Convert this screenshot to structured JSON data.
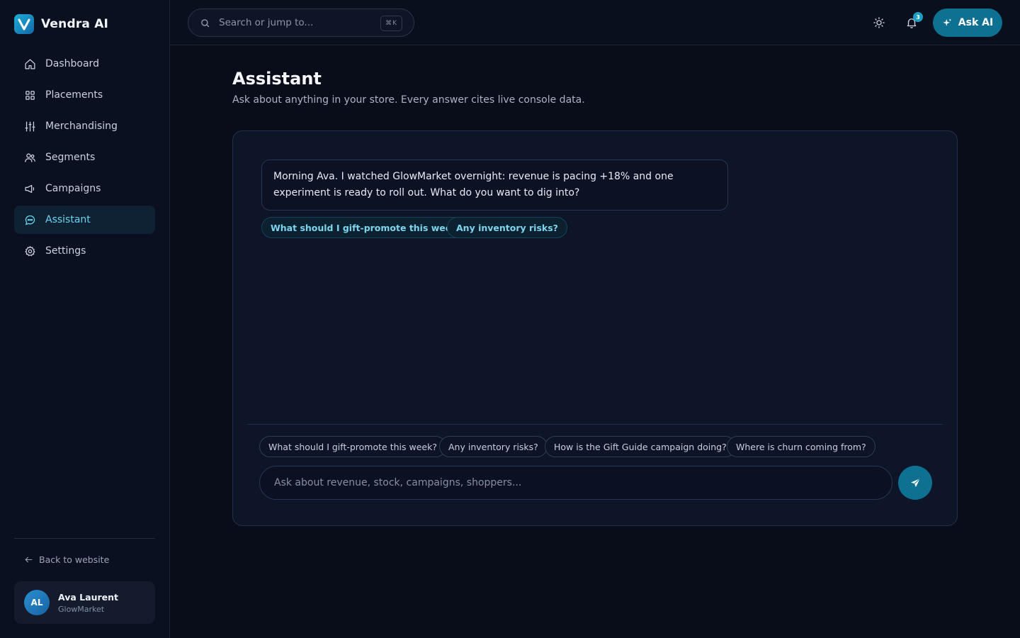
{
  "brand": {
    "name": "Vendra AI"
  },
  "sidebar": {
    "items": [
      {
        "label": "Dashboard",
        "icon": "home-icon",
        "active": false
      },
      {
        "label": "Placements",
        "icon": "grid-icon",
        "active": false
      },
      {
        "label": "Merchandising",
        "icon": "sliders-icon",
        "active": false
      },
      {
        "label": "Segments",
        "icon": "users-icon",
        "active": false
      },
      {
        "label": "Campaigns",
        "icon": "megaphone-icon",
        "active": false
      },
      {
        "label": "Assistant",
        "icon": "chat-bubble-icon",
        "active": true
      },
      {
        "label": "Settings",
        "icon": "gear-icon",
        "active": false
      }
    ],
    "back_link": "Back to website",
    "user": {
      "initials": "AL",
      "name": "Ava Laurent",
      "org": "GlowMarket"
    }
  },
  "topbar": {
    "search_placeholder": "Search or jump to...",
    "search_shortcut": "⌘K",
    "notification_count": "3",
    "ask_button": "Ask AI"
  },
  "page": {
    "title": "Assistant",
    "subtitle": "Ask about anything in your store. Every answer cites live console data."
  },
  "chat": {
    "message": "Morning Ava. I watched GlowMarket overnight: revenue is pacing +18% and one experiment is ready to roll out. What do you want to dig into?",
    "inline_suggestions": [
      "What should I gift-promote this week?",
      "Any inventory risks?"
    ],
    "quick_prompts": [
      "What should I gift-promote this week?",
      "Any inventory risks?",
      "How is the Gift Guide campaign doing?",
      "Where is churn coming from?"
    ],
    "input_placeholder": "Ask about revenue, stock, campaigns, shoppers..."
  },
  "colors": {
    "accent": "#0f7192",
    "accent_text": "#6dd3f0",
    "background": "#090d1a"
  }
}
